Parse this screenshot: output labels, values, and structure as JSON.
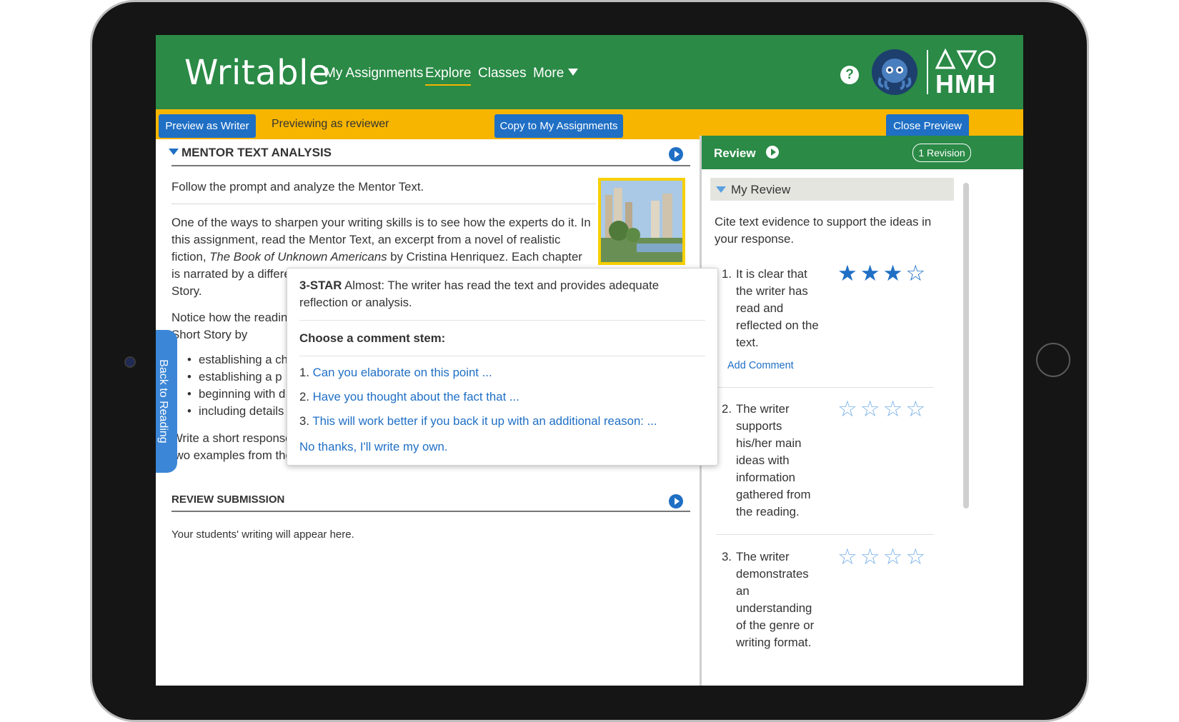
{
  "header": {
    "logo": "Writable",
    "nav": [
      {
        "label": "My Assignments"
      },
      {
        "label": "Explore"
      },
      {
        "label": "Classes"
      },
      {
        "label": "More"
      }
    ],
    "help": "?",
    "brand": "HMH"
  },
  "preview_bar": {
    "preview_writer": "Preview as Writer",
    "status": "Previewing as reviewer",
    "copy": "Copy to My Assignments",
    "close": "Close Preview"
  },
  "mentor": {
    "title": "MENTOR TEXT ANALYSIS",
    "prompt": "Follow the prompt and analyze the Mentor Text.",
    "para_lines": [
      "One of the ways to sharpen your writing skills is to see how the experts do it. In",
      "this assignment, read the Mentor Text, an excerpt from a novel of realistic"
    ],
    "line3_pre": "fiction, ",
    "line3_title": "The Book of Unknown Americans",
    "line3_post": " by Cristina Henriquez. Each chapter",
    "line4": "is narrated by a differe",
    "line5": "Story.",
    "notice_lines": [
      "Notice how the reading",
      "Short Story by"
    ],
    "bullets": [
      "establishing a ch",
      "establishing a p",
      "beginning with d",
      "including details"
    ],
    "write_lines": [
      "Write a short response",
      "two examples from the"
    ]
  },
  "back_tab": "Back to Reading",
  "review_submission": {
    "title": "REVIEW SUBMISSION",
    "placeholder": "Your students' writing will appear here."
  },
  "popup": {
    "rating_bold": "3-STAR",
    "rating_text_1": " Almost: The writer has read the text and provides adequate",
    "rating_text_2": "reflection or analysis.",
    "choose": "Choose a comment stem:",
    "stems": [
      {
        "num": "1.",
        "text": "Can you elaborate on this point ..."
      },
      {
        "num": "2.",
        "text": "Have you thought about the fact that ..."
      },
      {
        "num": "3.",
        "text": "This will work better if you back it up with an additional reason: ..."
      }
    ],
    "no_thanks": "No thanks, I'll write my own."
  },
  "review": {
    "title": "Review",
    "revision": "1 Revision",
    "my_review": "My Review",
    "intro_lines": [
      "Cite text evidence to support the ideas in",
      "your response."
    ],
    "criteria": [
      {
        "num": "1.",
        "lines": [
          "It is clear that",
          "the writer has",
          "read and",
          "reflected on the",
          "text."
        ],
        "rating": 3,
        "max": 4
      },
      {
        "num": "2.",
        "lines": [
          "The writer",
          "supports",
          "his/her main",
          "ideas with",
          "information",
          "gathered from",
          "the reading."
        ],
        "rating": 0,
        "max": 4
      },
      {
        "num": "3.",
        "lines": [
          "The writer",
          "demonstrates",
          "an",
          "understanding",
          "of the genre or",
          "writing format."
        ],
        "rating": 0,
        "max": 4
      }
    ],
    "add_comment": "Add Comment"
  }
}
